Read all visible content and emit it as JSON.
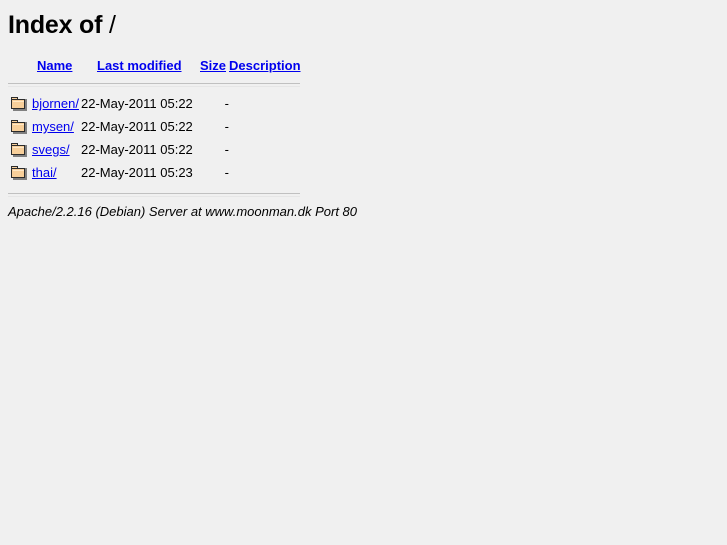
{
  "page": {
    "title_prefix": "Index of ",
    "path": "/",
    "background_color": "#f0f0f0",
    "link_color": "#0000ee",
    "text_color": "#000000",
    "rule_color": "#c0c0c0"
  },
  "table": {
    "headers": [
      {
        "label": "Name",
        "name": "column-header-name"
      },
      {
        "label": "Last modified",
        "name": "column-header-last-modified"
      },
      {
        "label": "Size",
        "name": "column-header-size"
      },
      {
        "label": "Description",
        "name": "column-header-description"
      }
    ],
    "rows": [
      {
        "icon": "folder-icon",
        "name": "bjornen/",
        "last_modified": "22-May-2011 05:22",
        "size": "-",
        "description": ""
      },
      {
        "icon": "folder-icon",
        "name": "mysen/",
        "last_modified": "22-May-2011 05:22",
        "size": "-",
        "description": ""
      },
      {
        "icon": "folder-icon",
        "name": "svegs/",
        "last_modified": "22-May-2011 05:22",
        "size": "-",
        "description": ""
      },
      {
        "icon": "folder-icon",
        "name": "thai/",
        "last_modified": "22-May-2011 05:23",
        "size": "-",
        "description": ""
      }
    ]
  },
  "footer": {
    "text": "Apache/2.2.16 (Debian) Server at www.moonman.dk Port 80"
  }
}
